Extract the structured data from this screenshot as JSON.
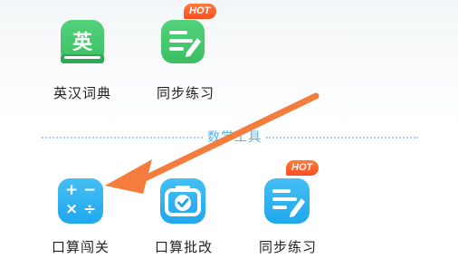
{
  "section": {
    "title": "数学工具"
  },
  "apps_row1": [
    {
      "label": "英汉词典",
      "icon_name": "dictionary-book-icon",
      "glyph": "英",
      "color": "#44c56b"
    },
    {
      "label": "同步练习",
      "icon_name": "practice-sheet-icon",
      "badge": "HOT",
      "color": "#44c56b"
    }
  ],
  "apps_row2": [
    {
      "label": "口算闯关",
      "icon_name": "calculator-icon",
      "glyphs": [
        "+",
        "−",
        "×",
        "÷"
      ],
      "color": "#29aaf0"
    },
    {
      "label": "口算批改",
      "icon_name": "camera-check-icon",
      "color": "#29aaf0"
    },
    {
      "label": "同步练习",
      "icon_name": "practice-sheet-icon",
      "badge": "HOT",
      "color": "#29aaf0"
    }
  ],
  "annotation": {
    "icon_name": "orange-arrow-icon",
    "color": "#f47c3c"
  }
}
